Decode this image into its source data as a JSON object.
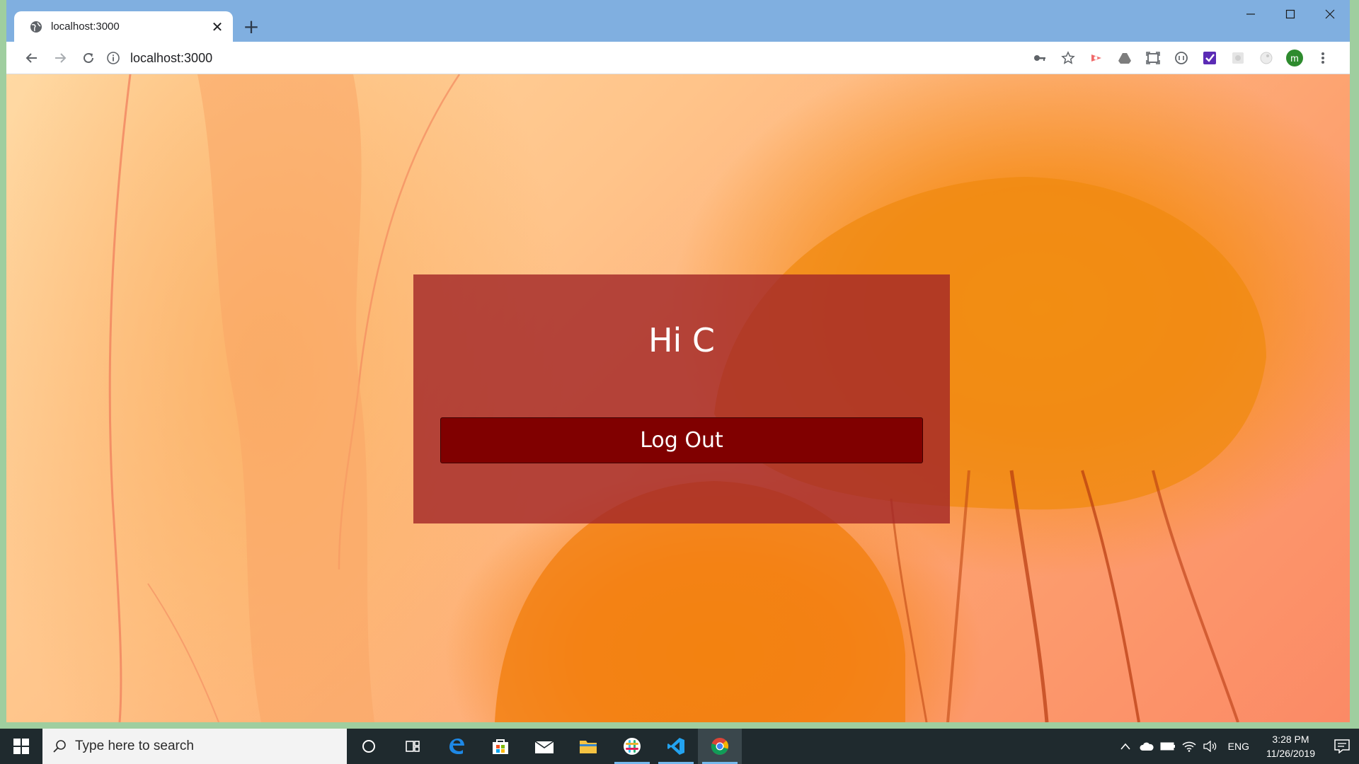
{
  "browser": {
    "tab": {
      "title": "localhost:3000",
      "close_glyph": "✕"
    },
    "new_tab_glyph": "+",
    "address": {
      "url": "localhost:3000"
    },
    "window_controls": {
      "minimize": "—",
      "maximize": "☐",
      "close": "✕"
    },
    "extensions": [
      "key-icon",
      "star-icon",
      "ext-red-icon",
      "drive-icon",
      "screenshot-icon",
      "ext-circle-icon",
      "ext-check-icon",
      "ext-gray-icon",
      "ext-face-icon"
    ],
    "profile_initial": "m"
  },
  "page": {
    "greeting": "Hi C",
    "logout_label": "Log Out",
    "colors": {
      "card": "#a42828",
      "button": "#800000",
      "text": "#ffffff"
    }
  },
  "taskbar": {
    "search_placeholder": "Type here to search",
    "apps": [
      "cortana-icon",
      "task-view-icon",
      "edge-icon",
      "store-icon",
      "mail-icon",
      "file-explorer-icon",
      "slack-icon",
      "vscode-icon",
      "chrome-icon"
    ],
    "language": "ENG",
    "time": "3:28 PM",
    "date": "11/26/2019"
  }
}
